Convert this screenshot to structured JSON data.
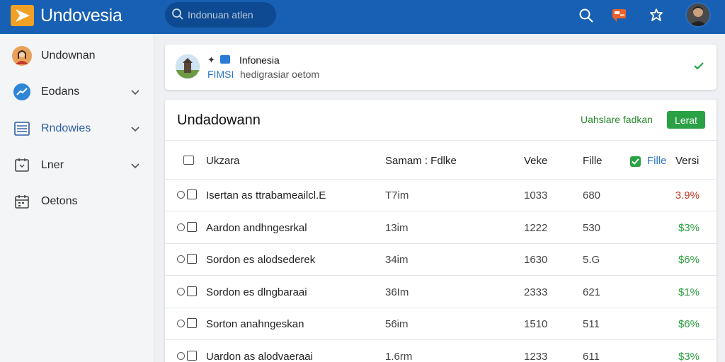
{
  "header": {
    "brand": "Undovesia",
    "search": {
      "placeholder": "Indonuan atlen",
      "value": ""
    },
    "icons": [
      "search-icon",
      "flag-icon",
      "puzzle-icon",
      "avatar"
    ]
  },
  "sidebar": {
    "items": [
      {
        "label": "Undownan",
        "icon": "avatar"
      },
      {
        "label": "Eodans",
        "icon": "chart-icon",
        "chevron": true
      },
      {
        "label": "Rndowies",
        "icon": "list-icon",
        "chevron": true,
        "active": true
      },
      {
        "label": "Lner",
        "icon": "board-icon",
        "chevron": true
      },
      {
        "label": "Oetons",
        "icon": "calendar-icon"
      }
    ]
  },
  "notice": {
    "pin": "✦",
    "title": "Infonesia",
    "tag": "FIMSI",
    "text": "hedigrasiar oetom"
  },
  "card": {
    "title": "Undadowann",
    "link": "Uahslare fadkan",
    "button": "Lerat",
    "columns": {
      "name": "Ukzara",
      "size": "Samam : Fdlke",
      "num": "Veke",
      "file": "Fille",
      "check_label": "Fille",
      "pct": "Versi"
    },
    "rows": [
      {
        "name": "Isertan as ttrabameailcl.E",
        "size": "T7im",
        "num": "1033",
        "file": "680",
        "pct": "3.9%",
        "pct_color": "#c0392b"
      },
      {
        "name": "Aardon andhngesrkal",
        "size": "13im",
        "num": "1222",
        "file": "530",
        "pct": "$3%",
        "pct_color": "#2a9d3c"
      },
      {
        "name": "Sordon es alodsederek",
        "size": "34im",
        "num": "1630",
        "file": "5.G",
        "pct": "$6%",
        "pct_color": "#2a9d3c"
      },
      {
        "name": "Sordon es dlngbaraai",
        "size": "36Im",
        "num": "2333",
        "file": "621",
        "pct": "$1%",
        "pct_color": "#2a9d3c"
      },
      {
        "name": "Sorton anahngeskan",
        "size": "56im",
        "num": "1510",
        "file": "511",
        "pct": "$6%",
        "pct_color": "#2a9d3c"
      },
      {
        "name": "Uardon as alodvaeraai",
        "size": "1.6rm",
        "num": "1233",
        "file": "611",
        "pct": "$3%",
        "pct_color": "#2a9d3c"
      }
    ]
  },
  "colors": {
    "topbar": "#1860b3",
    "accent_green": "#2aa144",
    "logo": "#f0a024"
  }
}
